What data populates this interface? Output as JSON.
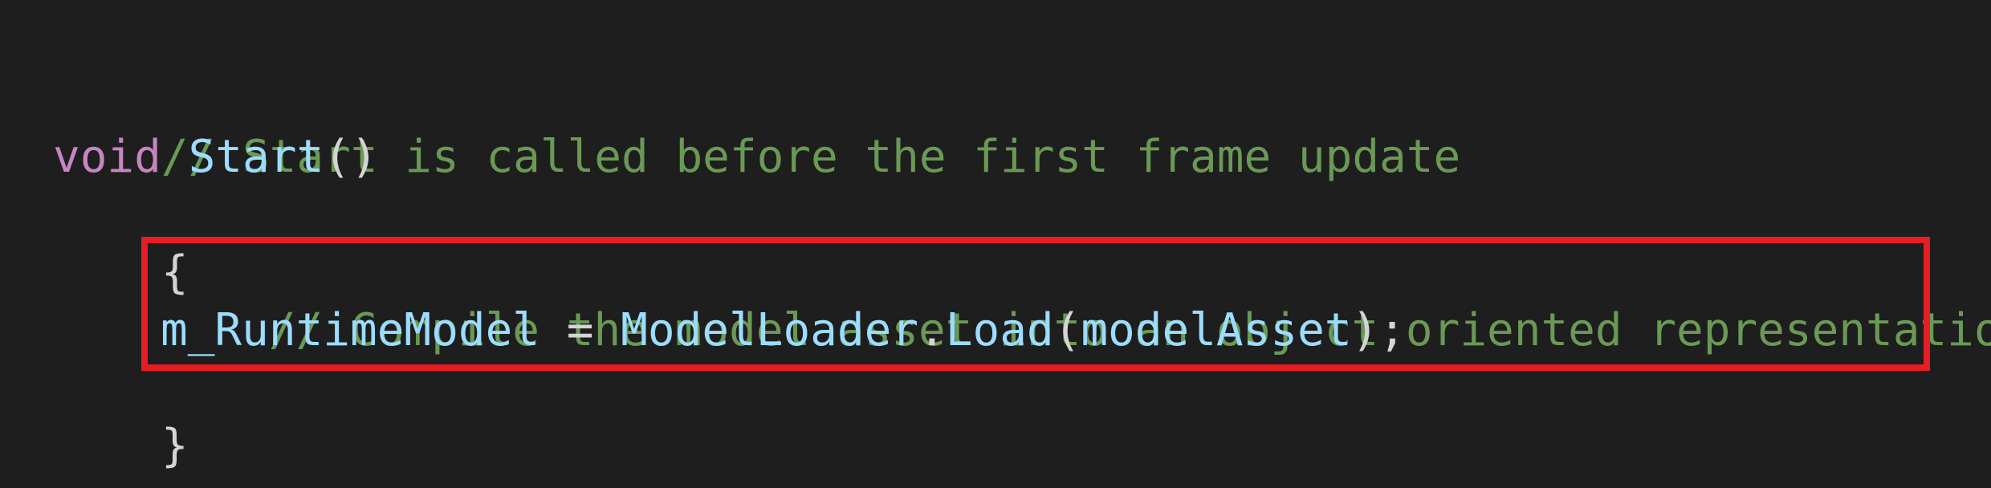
{
  "code": {
    "line1": {
      "comment": "// Start is called before the first frame update"
    },
    "line2": {
      "keyword": "void",
      "space": " ",
      "name": "Start",
      "parens": "()"
    },
    "line3": {
      "brace": "{"
    },
    "line4": {
      "comment": "// Compile the model asset into an object oriented representation"
    },
    "line5": {
      "lhs": "m_RuntimeModel",
      "op": " = ",
      "cls": "ModelLoader",
      "dot": ".",
      "method": "Load",
      "open": "(",
      "arg": "modelAsset",
      "close": ");"
    },
    "line6": {
      "brace": "}"
    }
  },
  "colors": {
    "background": "#1e1e1e",
    "comment": "#6a9955",
    "keyword": "#c586c0",
    "identifier": "#9cdcfe",
    "punctuation": "#d4d4d4",
    "highlight": "#e81c24"
  }
}
